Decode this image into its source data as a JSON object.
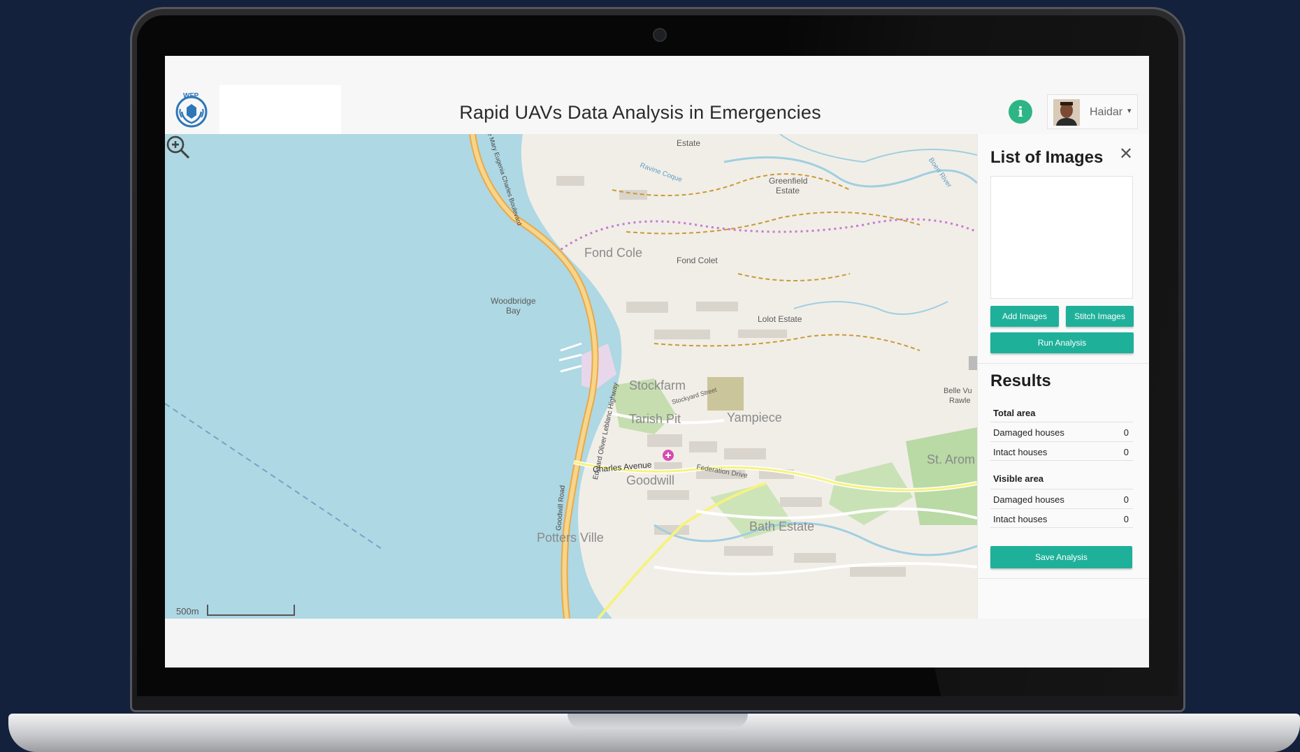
{
  "header": {
    "logo_text": "WFP",
    "title": "Rapid UAVs Data Analysis in Emergencies",
    "info_icon": "i",
    "user": {
      "name": "Haidar",
      "caret": "▾"
    }
  },
  "map": {
    "labels": {
      "estate_top": "Estate",
      "greenfield": "Greenfield",
      "greenfield_estate": "Estate",
      "ravine_coque": "Ravine Coque",
      "boeri_river": "Boeri River",
      "fond_cole": "Fond Cole",
      "fond_colet": "Fond Colet",
      "woodbridge": "Woodbridge",
      "bay": "Bay",
      "lolot_estate": "Lolot Estate",
      "highway_top": "Dame Mary Eugenia Charles Boulevard",
      "highway_mid": "Edward Oliver Leblanc Highway",
      "highway_low": "Edward Oliver Leblanc Highway",
      "stockfarm": "Stockfarm",
      "stockyard_street": "Stockyard Street",
      "belle_vue": "Belle Vu",
      "rawle": "Rawle",
      "tarish_pit": "Tarish Pit",
      "yampiece": "Yampiece",
      "st_aromant": "St. Arom",
      "charles_avenue": "Charles Avenue",
      "federation_drive": "Federation Drive",
      "goodwill": "Goodwill",
      "goodwill_road": "Goodwill Road",
      "bath_estate": "Bath Estate",
      "potters_ville": "Potters Ville"
    },
    "scale_text": "500m"
  },
  "panel": {
    "images_title": "List of Images",
    "close": "✕",
    "add_images": "Add Images",
    "stitch_images": "Stitch Images",
    "run_analysis": "Run Analysis",
    "results_title": "Results",
    "total_area": {
      "label": "Total area",
      "damaged_label": "Damaged houses",
      "damaged_value": "0",
      "intact_label": "Intact houses",
      "intact_value": "0"
    },
    "visible_area": {
      "label": "Visible area",
      "damaged_label": "Damaged houses",
      "damaged_value": "0",
      "intact_label": "Intact houses",
      "intact_value": "0"
    },
    "save_analysis": "Save Analysis"
  },
  "colors": {
    "accent": "#1fb09a",
    "info": "#2db586",
    "water": "#aed8e3",
    "background": "#14213d"
  }
}
